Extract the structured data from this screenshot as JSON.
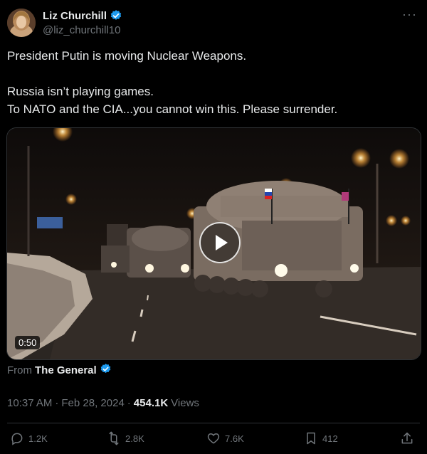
{
  "author": {
    "display_name": "Liz Churchill",
    "handle": "@liz_churchill10"
  },
  "more_label": "···",
  "tweet": {
    "lines": [
      "President Putin is moving Nuclear Weapons.",
      "Russia isn’t playing games.",
      "To NATO and the CIA...you cannot win this. Please surrender."
    ]
  },
  "media": {
    "duration": "0:50"
  },
  "source": {
    "prefix": "From",
    "name": "The General"
  },
  "meta": {
    "time": "10:37 AM",
    "sep": "·",
    "date": "Feb 28, 2024",
    "sep2": "·",
    "views_count": "454.1K",
    "views_label": "Views"
  },
  "actions": {
    "replies": "1.2K",
    "reposts": "2.8K",
    "likes": "7.6K",
    "bookmarks": "412"
  },
  "colors": {
    "verified": "#1d9bf0",
    "muted": "#71767b",
    "text": "#e7e9ea",
    "background": "#000000"
  }
}
